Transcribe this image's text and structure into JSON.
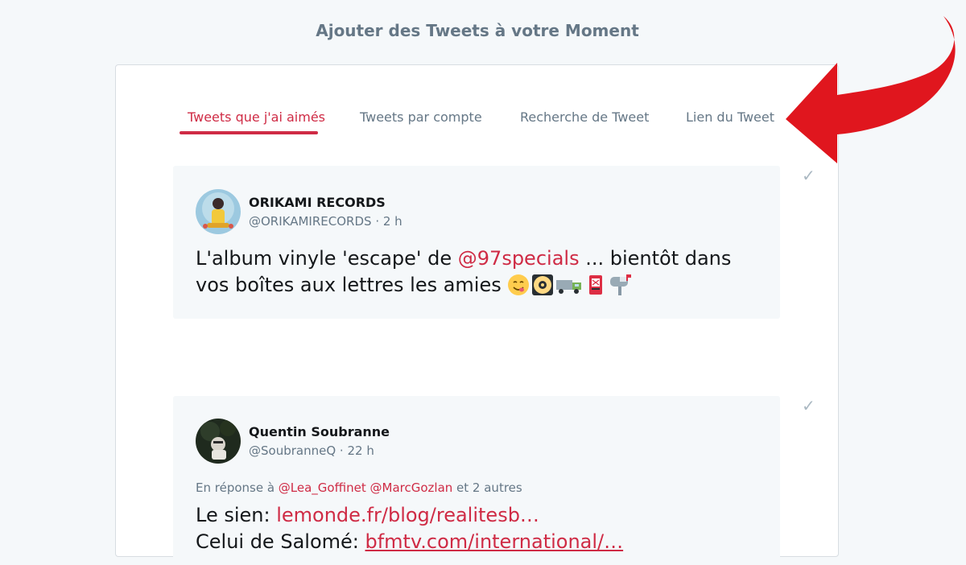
{
  "page": {
    "title": "Ajouter des Tweets à votre Moment"
  },
  "tabs": [
    {
      "label": "Tweets que j'ai aimés",
      "active": true
    },
    {
      "label": "Tweets par compte",
      "active": false
    },
    {
      "label": "Recherche de Tweet",
      "active": false
    },
    {
      "label": "Lien du Tweet",
      "active": false
    }
  ],
  "tweets": [
    {
      "name": "ORIKAMI RECORDS",
      "handle": "@ORIKAMIRECORDS",
      "time": "2 h",
      "text_before": "L'album vinyle 'escape' de ",
      "mention": "@97specials",
      "text_after": " ... bientôt dans vos boîtes aux lettres les amies ",
      "emojis": [
        "smiling-face-icon",
        "vinyl-disc-icon",
        "delivery-truck-icon",
        "postbox-icon",
        "mailbox-icon"
      ]
    },
    {
      "name": "Quentin Soubranne",
      "handle": "@SoubranneQ",
      "time": "22 h",
      "reply_prefix": "En réponse à ",
      "reply_mentions": [
        "@Lea_Goffinet",
        "@MarcGozlan"
      ],
      "reply_suffix": " et 2 autres",
      "line1_prefix": "Le sien: ",
      "line1_link": "lemonde.fr/blog/realitesb…",
      "line2_prefix": "Celui de Salomé: ",
      "line2_link": "bfmtv.com/international/…"
    }
  ],
  "icons": {
    "check": "✓",
    "annotation_arrow": "red-curved-arrow-icon"
  },
  "colors": {
    "accent": "#cf2b45",
    "muted": "#657786",
    "arrow": "#e0161e"
  }
}
